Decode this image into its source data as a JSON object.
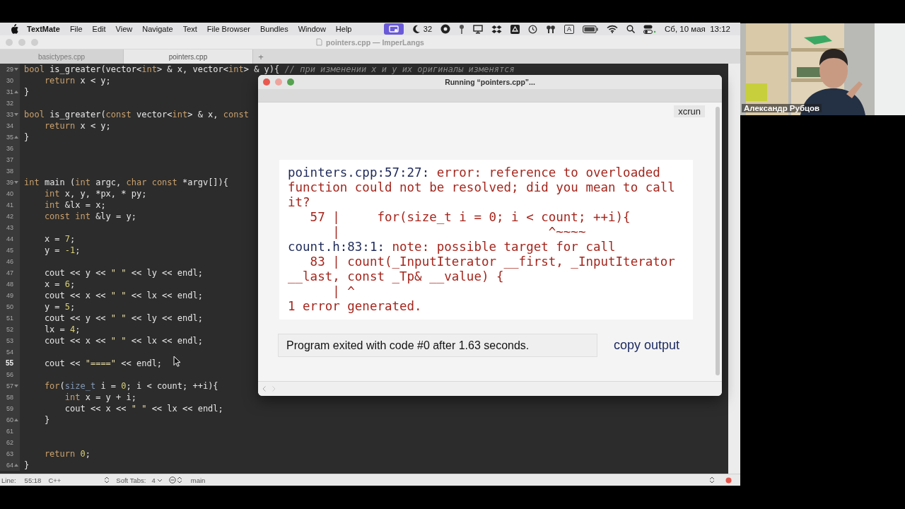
{
  "menu_bar": {
    "app": "TextMate",
    "items": [
      "File",
      "Edit",
      "View",
      "Navigate",
      "Text",
      "File Browser",
      "Bundles",
      "Window",
      "Help"
    ],
    "status_items": [
      {
        "kind": "screen-share"
      },
      {
        "kind": "crescent",
        "text": "32"
      },
      {
        "kind": "dark-circle"
      },
      {
        "kind": "pin"
      },
      {
        "kind": "monitor"
      },
      {
        "kind": "diamonds"
      },
      {
        "kind": "triangle"
      },
      {
        "kind": "clock"
      },
      {
        "kind": "earbuds"
      },
      {
        "kind": "input-source",
        "text": "A"
      },
      {
        "kind": "battery"
      },
      {
        "kind": "wifi"
      },
      {
        "kind": "search"
      },
      {
        "kind": "toggles"
      }
    ],
    "clock": "Сб, 10 мая  13:12"
  },
  "window": {
    "title": "pointers.cpp — ImperLangs",
    "tabs": [
      {
        "label": "basictypes.cpp",
        "selected": false
      },
      {
        "label": "pointers.cpp",
        "selected": true
      }
    ],
    "new_tab": "+"
  },
  "editor": {
    "lines": [
      {
        "number": "29",
        "kind": "fold-start",
        "current": false,
        "segments": [
          {
            "kind": "keyword",
            "text": "bool"
          },
          {
            "kind": "plain",
            "text": " is_greater(vector<"
          },
          {
            "kind": "keyword",
            "text": "int"
          },
          {
            "kind": "plain",
            "text": "> & x, vector<"
          },
          {
            "kind": "keyword",
            "text": "int"
          },
          {
            "kind": "plain",
            "text": "> & y){ "
          },
          {
            "kind": "comment",
            "text": "// при изменении x и y их оригиналы изменятся"
          }
        ]
      },
      {
        "number": "30",
        "kind": "plain",
        "current": false,
        "segments": [
          {
            "kind": "keyword",
            "text": "    return"
          },
          {
            "kind": "plain",
            "text": " x < y;"
          }
        ]
      },
      {
        "number": "31",
        "kind": "fold-end",
        "current": false,
        "segments": [
          {
            "kind": "plain",
            "text": "}"
          }
        ]
      },
      {
        "number": "32",
        "kind": "plain",
        "current": false
      },
      {
        "number": "33",
        "kind": "fold-start",
        "current": false,
        "segments": [
          {
            "kind": "keyword",
            "text": "bool"
          },
          {
            "kind": "plain",
            "text": " is_greater("
          },
          {
            "kind": "keyword",
            "text": "const"
          },
          {
            "kind": "plain",
            "text": " vector<"
          },
          {
            "kind": "keyword",
            "text": "int"
          },
          {
            "kind": "plain",
            "text": "> & x, "
          },
          {
            "kind": "keyword",
            "text": "const"
          }
        ]
      },
      {
        "number": "34",
        "kind": "plain",
        "current": false,
        "segments": [
          {
            "kind": "keyword",
            "text": "    return"
          },
          {
            "kind": "plain",
            "text": " x < y;"
          }
        ]
      },
      {
        "number": "35",
        "kind": "fold-end",
        "current": false,
        "segments": [
          {
            "kind": "plain",
            "text": "}"
          }
        ]
      },
      {
        "number": "36",
        "kind": "plain",
        "current": false
      },
      {
        "number": "37",
        "kind": "plain",
        "current": false
      },
      {
        "number": "38",
        "kind": "plain",
        "current": false
      },
      {
        "number": "39",
        "kind": "fold-start",
        "current": false,
        "segments": [
          {
            "kind": "keyword",
            "text": "int"
          },
          {
            "kind": "plain",
            "text": " main ("
          },
          {
            "kind": "keyword",
            "text": "int"
          },
          {
            "kind": "plain",
            "text": " argc, "
          },
          {
            "kind": "keyword",
            "text": "char const"
          },
          {
            "kind": "plain",
            "text": " *argv[]){"
          }
        ]
      },
      {
        "number": "40",
        "kind": "plain",
        "current": false,
        "segments": [
          {
            "kind": "keyword",
            "text": "    int"
          },
          {
            "kind": "plain",
            "text": " x, y, *px, * py;"
          }
        ]
      },
      {
        "number": "41",
        "kind": "plain",
        "current": false,
        "segments": [
          {
            "kind": "keyword",
            "text": "    int"
          },
          {
            "kind": "plain",
            "text": " &lx = x;"
          }
        ]
      },
      {
        "number": "42",
        "kind": "plain",
        "current": false,
        "segments": [
          {
            "kind": "keyword",
            "text": "    const int"
          },
          {
            "kind": "plain",
            "text": " &ly = y;"
          }
        ]
      },
      {
        "number": "43",
        "kind": "plain",
        "current": false
      },
      {
        "number": "44",
        "kind": "plain",
        "current": false,
        "segments": [
          {
            "kind": "plain",
            "text": "    x = "
          },
          {
            "kind": "number",
            "text": "7"
          },
          {
            "kind": "plain",
            "text": ";"
          }
        ]
      },
      {
        "number": "45",
        "kind": "plain",
        "current": false,
        "segments": [
          {
            "kind": "plain",
            "text": "    y = "
          },
          {
            "kind": "number",
            "text": "-1"
          },
          {
            "kind": "plain",
            "text": ";"
          }
        ]
      },
      {
        "number": "46",
        "kind": "plain",
        "current": false
      },
      {
        "number": "47",
        "kind": "plain",
        "current": false,
        "segments": [
          {
            "kind": "plain",
            "text": "    cout << y << "
          },
          {
            "kind": "string",
            "text": "\" \""
          },
          {
            "kind": "plain",
            "text": " << ly << endl;"
          }
        ]
      },
      {
        "number": "48",
        "kind": "plain",
        "current": false,
        "segments": [
          {
            "kind": "plain",
            "text": "    x = "
          },
          {
            "kind": "number",
            "text": "6"
          },
          {
            "kind": "plain",
            "text": ";"
          }
        ]
      },
      {
        "number": "49",
        "kind": "plain",
        "current": false,
        "segments": [
          {
            "kind": "plain",
            "text": "    cout << x << "
          },
          {
            "kind": "string",
            "text": "\" \""
          },
          {
            "kind": "plain",
            "text": " << lx << endl;"
          }
        ]
      },
      {
        "number": "50",
        "kind": "plain",
        "current": false,
        "segments": [
          {
            "kind": "plain",
            "text": "    y = "
          },
          {
            "kind": "number",
            "text": "5"
          },
          {
            "kind": "plain",
            "text": ";"
          }
        ]
      },
      {
        "number": "51",
        "kind": "plain",
        "current": false,
        "segments": [
          {
            "kind": "plain",
            "text": "    cout << y << "
          },
          {
            "kind": "string",
            "text": "\" \""
          },
          {
            "kind": "plain",
            "text": " << ly << endl;"
          }
        ]
      },
      {
        "number": "52",
        "kind": "plain",
        "current": false,
        "segments": [
          {
            "kind": "plain",
            "text": "    lx = "
          },
          {
            "kind": "number",
            "text": "4"
          },
          {
            "kind": "plain",
            "text": ";"
          }
        ]
      },
      {
        "number": "53",
        "kind": "plain",
        "current": false,
        "segments": [
          {
            "kind": "plain",
            "text": "    cout << x << "
          },
          {
            "kind": "string",
            "text": "\" \""
          },
          {
            "kind": "plain",
            "text": " << lx << endl;"
          }
        ]
      },
      {
        "number": "54",
        "kind": "plain",
        "current": false
      },
      {
        "number": "55",
        "kind": "plain",
        "current": true,
        "segments": [
          {
            "kind": "plain",
            "text": "    cout << "
          },
          {
            "kind": "string",
            "text": "\"====\""
          },
          {
            "kind": "plain",
            "text": " << endl;"
          }
        ]
      },
      {
        "number": "56",
        "kind": "plain",
        "current": false
      },
      {
        "number": "57",
        "kind": "fold-start",
        "current": false,
        "segments": [
          {
            "kind": "keyword",
            "text": "    for"
          },
          {
            "kind": "plain",
            "text": "("
          },
          {
            "kind": "type",
            "text": "size_t"
          },
          {
            "kind": "plain",
            "text": " i = "
          },
          {
            "kind": "number",
            "text": "0"
          },
          {
            "kind": "plain",
            "text": "; i < count; ++i){"
          }
        ]
      },
      {
        "number": "58",
        "kind": "plain",
        "current": false,
        "segments": [
          {
            "kind": "keyword",
            "text": "        int"
          },
          {
            "kind": "plain",
            "text": " x = y + i;"
          }
        ]
      },
      {
        "number": "59",
        "kind": "plain",
        "current": false,
        "segments": [
          {
            "kind": "plain",
            "text": "        cout << x << "
          },
          {
            "kind": "string",
            "text": "\" \""
          },
          {
            "kind": "plain",
            "text": " << lx << endl;"
          }
        ]
      },
      {
        "number": "60",
        "kind": "fold-end",
        "current": false,
        "segments": [
          {
            "kind": "plain",
            "text": "    }"
          }
        ]
      },
      {
        "number": "61",
        "kind": "plain",
        "current": false
      },
      {
        "number": "62",
        "kind": "plain",
        "current": false
      },
      {
        "number": "63",
        "kind": "plain",
        "current": false,
        "segments": [
          {
            "kind": "keyword",
            "text": "    return"
          },
          {
            "kind": "number",
            "text": " 0"
          },
          {
            "kind": "plain",
            "text": ";"
          }
        ]
      },
      {
        "number": "64",
        "kind": "fold-end",
        "current": false,
        "segments": [
          {
            "kind": "plain",
            "text": "}"
          }
        ]
      }
    ]
  },
  "run_window": {
    "title": "Running “pointers.cpp”...",
    "runner": "xcrun",
    "output": [
      {
        "segments": [
          {
            "kind": "location",
            "text": "pointers.cpp:57:27:"
          },
          {
            "kind": "message",
            "text": " error: reference to overloaded"
          }
        ]
      },
      {
        "segments": [
          {
            "kind": "message",
            "text": "function could not be resolved; did you mean to call"
          }
        ]
      },
      {
        "segments": [
          {
            "kind": "message",
            "text": "it?"
          }
        ]
      },
      {
        "segments": [
          {
            "kind": "message",
            "text": "   57 |     for(size_t i = 0; i < count; ++i){"
          }
        ]
      },
      {
        "segments": [
          {
            "kind": "message",
            "text": "      |                            ^~~~~"
          }
        ]
      },
      {
        "segments": [
          {
            "kind": "location",
            "text": "count.h:83:1:"
          },
          {
            "kind": "message",
            "text": " note: possible target for call"
          }
        ]
      },
      {
        "segments": [
          {
            "kind": "message",
            "text": "   83 | count(_InputIterator __first, _InputIterator"
          }
        ]
      },
      {
        "segments": [
          {
            "kind": "message",
            "text": "__last, const _Tp& __value) {"
          }
        ]
      },
      {
        "segments": [
          {
            "kind": "message",
            "text": "      | ^"
          }
        ]
      },
      {
        "segments": [
          {
            "kind": "message",
            "text": "1 error generated."
          }
        ]
      }
    ],
    "exit_message": "Program exited with code #0 after 1.63 seconds.",
    "copy_link": "copy output"
  },
  "status_bar": {
    "line_label": "Line:",
    "position": "55:18",
    "language": "C++",
    "tabs_label": "Soft Tabs:",
    "tab_size": "4",
    "branch": "main"
  },
  "video_tile": {
    "kind": "picture",
    "name": "Александр Рубцов"
  }
}
